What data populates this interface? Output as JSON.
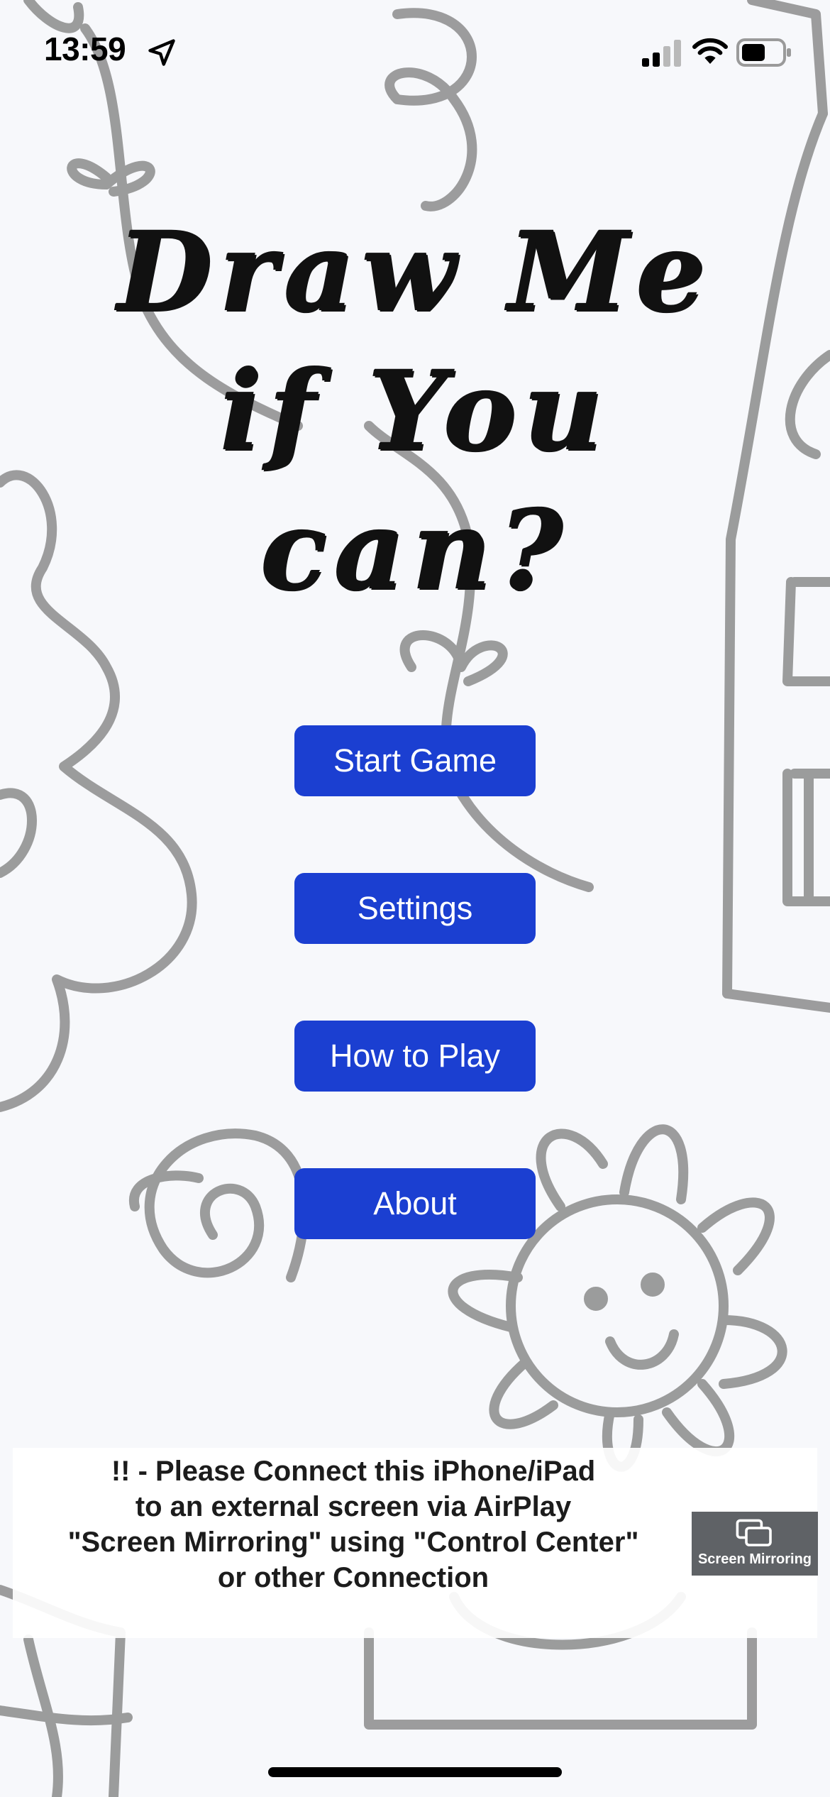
{
  "status_bar": {
    "time": "13:59",
    "icons": [
      "location-arrow-icon",
      "cellular-signal-icon",
      "wifi-icon",
      "battery-icon"
    ]
  },
  "title": {
    "lines": [
      "Draw Me",
      "if You",
      "can?"
    ]
  },
  "menu": {
    "start_game": "Start Game",
    "settings": "Settings",
    "how_to_play": "How to Play",
    "about": "About"
  },
  "notice": {
    "text": "!!  - Please Connect this iPhone/iPad\nto an external screen via AirPlay\n\"Screen Mirroring\" using \"Control Center\"\nor other Connection"
  },
  "screen_mirroring": {
    "label": "Screen Mirroring",
    "icon": "screen-mirroring-icon"
  },
  "colors": {
    "button": "#1b3fd1",
    "button_text": "#ffffff",
    "doodle": "#8a8a8a",
    "mirror_button": "#5f6266",
    "background": "#f7f8fb"
  }
}
